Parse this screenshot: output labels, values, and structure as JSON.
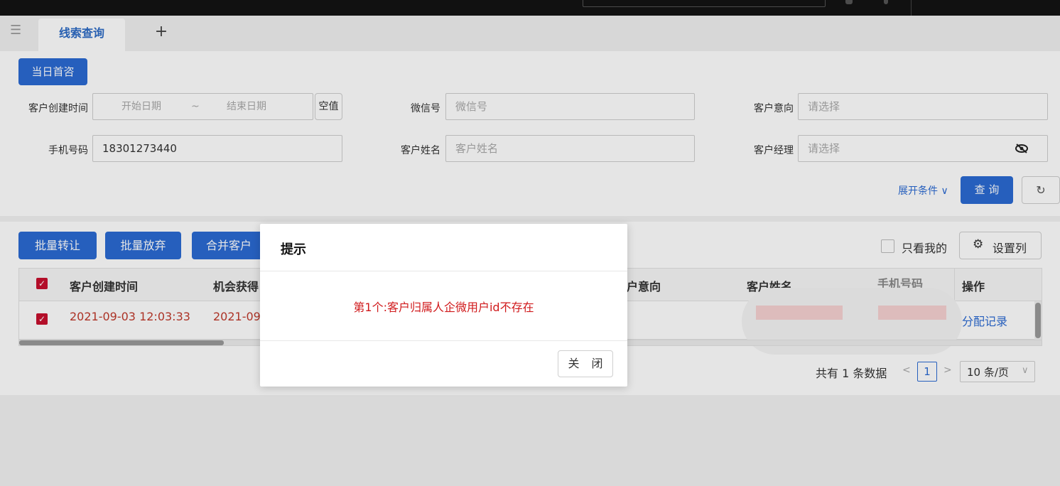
{
  "tabs": {
    "active_label": "线索查询",
    "add_symbol": "+"
  },
  "quick_filter": {
    "label": "当日首咨"
  },
  "form": {
    "create_time": {
      "label": "客户创建时间",
      "start_placeholder": "开始日期",
      "separator": "~",
      "end_placeholder": "结束日期",
      "null_button": "空值"
    },
    "wechat": {
      "label": "微信号",
      "placeholder": "微信号"
    },
    "intent": {
      "label": "客户意向",
      "placeholder": "请选择"
    },
    "phone": {
      "label": "手机号码",
      "value": "18301273440"
    },
    "name": {
      "label": "客户姓名",
      "placeholder": "客户姓名"
    },
    "manager": {
      "label": "客户经理",
      "placeholder": "请选择"
    },
    "expand_label": "展开条件",
    "query_label": "查 询",
    "refresh_symbol": "↻"
  },
  "toolbar": {
    "batch_transfer": "批量转让",
    "batch_abandon": "批量放弃",
    "merge_customer": "合并客户",
    "only_mine": "只看我的",
    "settings_columns": "设置列"
  },
  "table": {
    "headers": {
      "create_time": "客户创建时间",
      "opportunity_time": "机会获得",
      "intent": "户意向",
      "name": "客户姓名",
      "phone": "手机号码",
      "actions": "操作"
    },
    "rows": [
      {
        "create_time": "2021-09-03 12:03:33",
        "opportunity_time": "2021-09",
        "action_link": "分配记录"
      }
    ]
  },
  "pagination": {
    "total_text": "共有 1 条数据",
    "current_page": "1",
    "page_size": "10 条/页"
  },
  "dialog": {
    "title": "提示",
    "message": "第1个:客户归属人企微用户id不存在",
    "close_label": "关 闭"
  },
  "colors": {
    "primary": "#2b6ad3",
    "error_red": "#d0191b",
    "row_red": "#c0392b"
  }
}
